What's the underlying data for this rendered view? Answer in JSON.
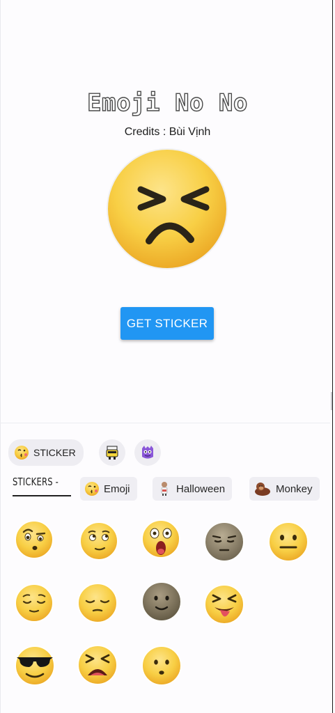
{
  "app": {
    "title": "Emoji No No",
    "credits": "Credits : Bùi Vịnh"
  },
  "main": {
    "featured_emoji": "squint-frown-emoji",
    "get_sticker_label": "GET STICKER"
  },
  "picker": {
    "top_chips": [
      {
        "label": "STICKER",
        "icon": "kissing-face-icon"
      },
      {
        "label": "",
        "icon": "nurse-character-icon"
      },
      {
        "label": "",
        "icon": "purple-monster-icon"
      }
    ],
    "tabs": [
      {
        "label": "STICKERS -",
        "active": true
      },
      {
        "label": "Emoji",
        "icon": "kissing-face-icon"
      },
      {
        "label": "Halloween",
        "icon": "zombie-icon"
      },
      {
        "label": "Monkey",
        "icon": "monkey-icon"
      }
    ],
    "stickers": [
      "raised-eyebrow-face",
      "rolling-eyes-face",
      "screaming-face",
      "sad-dark-face",
      "neutral-face",
      "relieved-face",
      "sleepy-face",
      "smiling-dark-face",
      "tongue-squint-face",
      "sunglasses-face",
      "tired-face",
      "worried-face"
    ]
  },
  "colors": {
    "accent": "#2196f3",
    "emoji_yellow": "#f8cf45",
    "background": "#fdfcfe"
  }
}
